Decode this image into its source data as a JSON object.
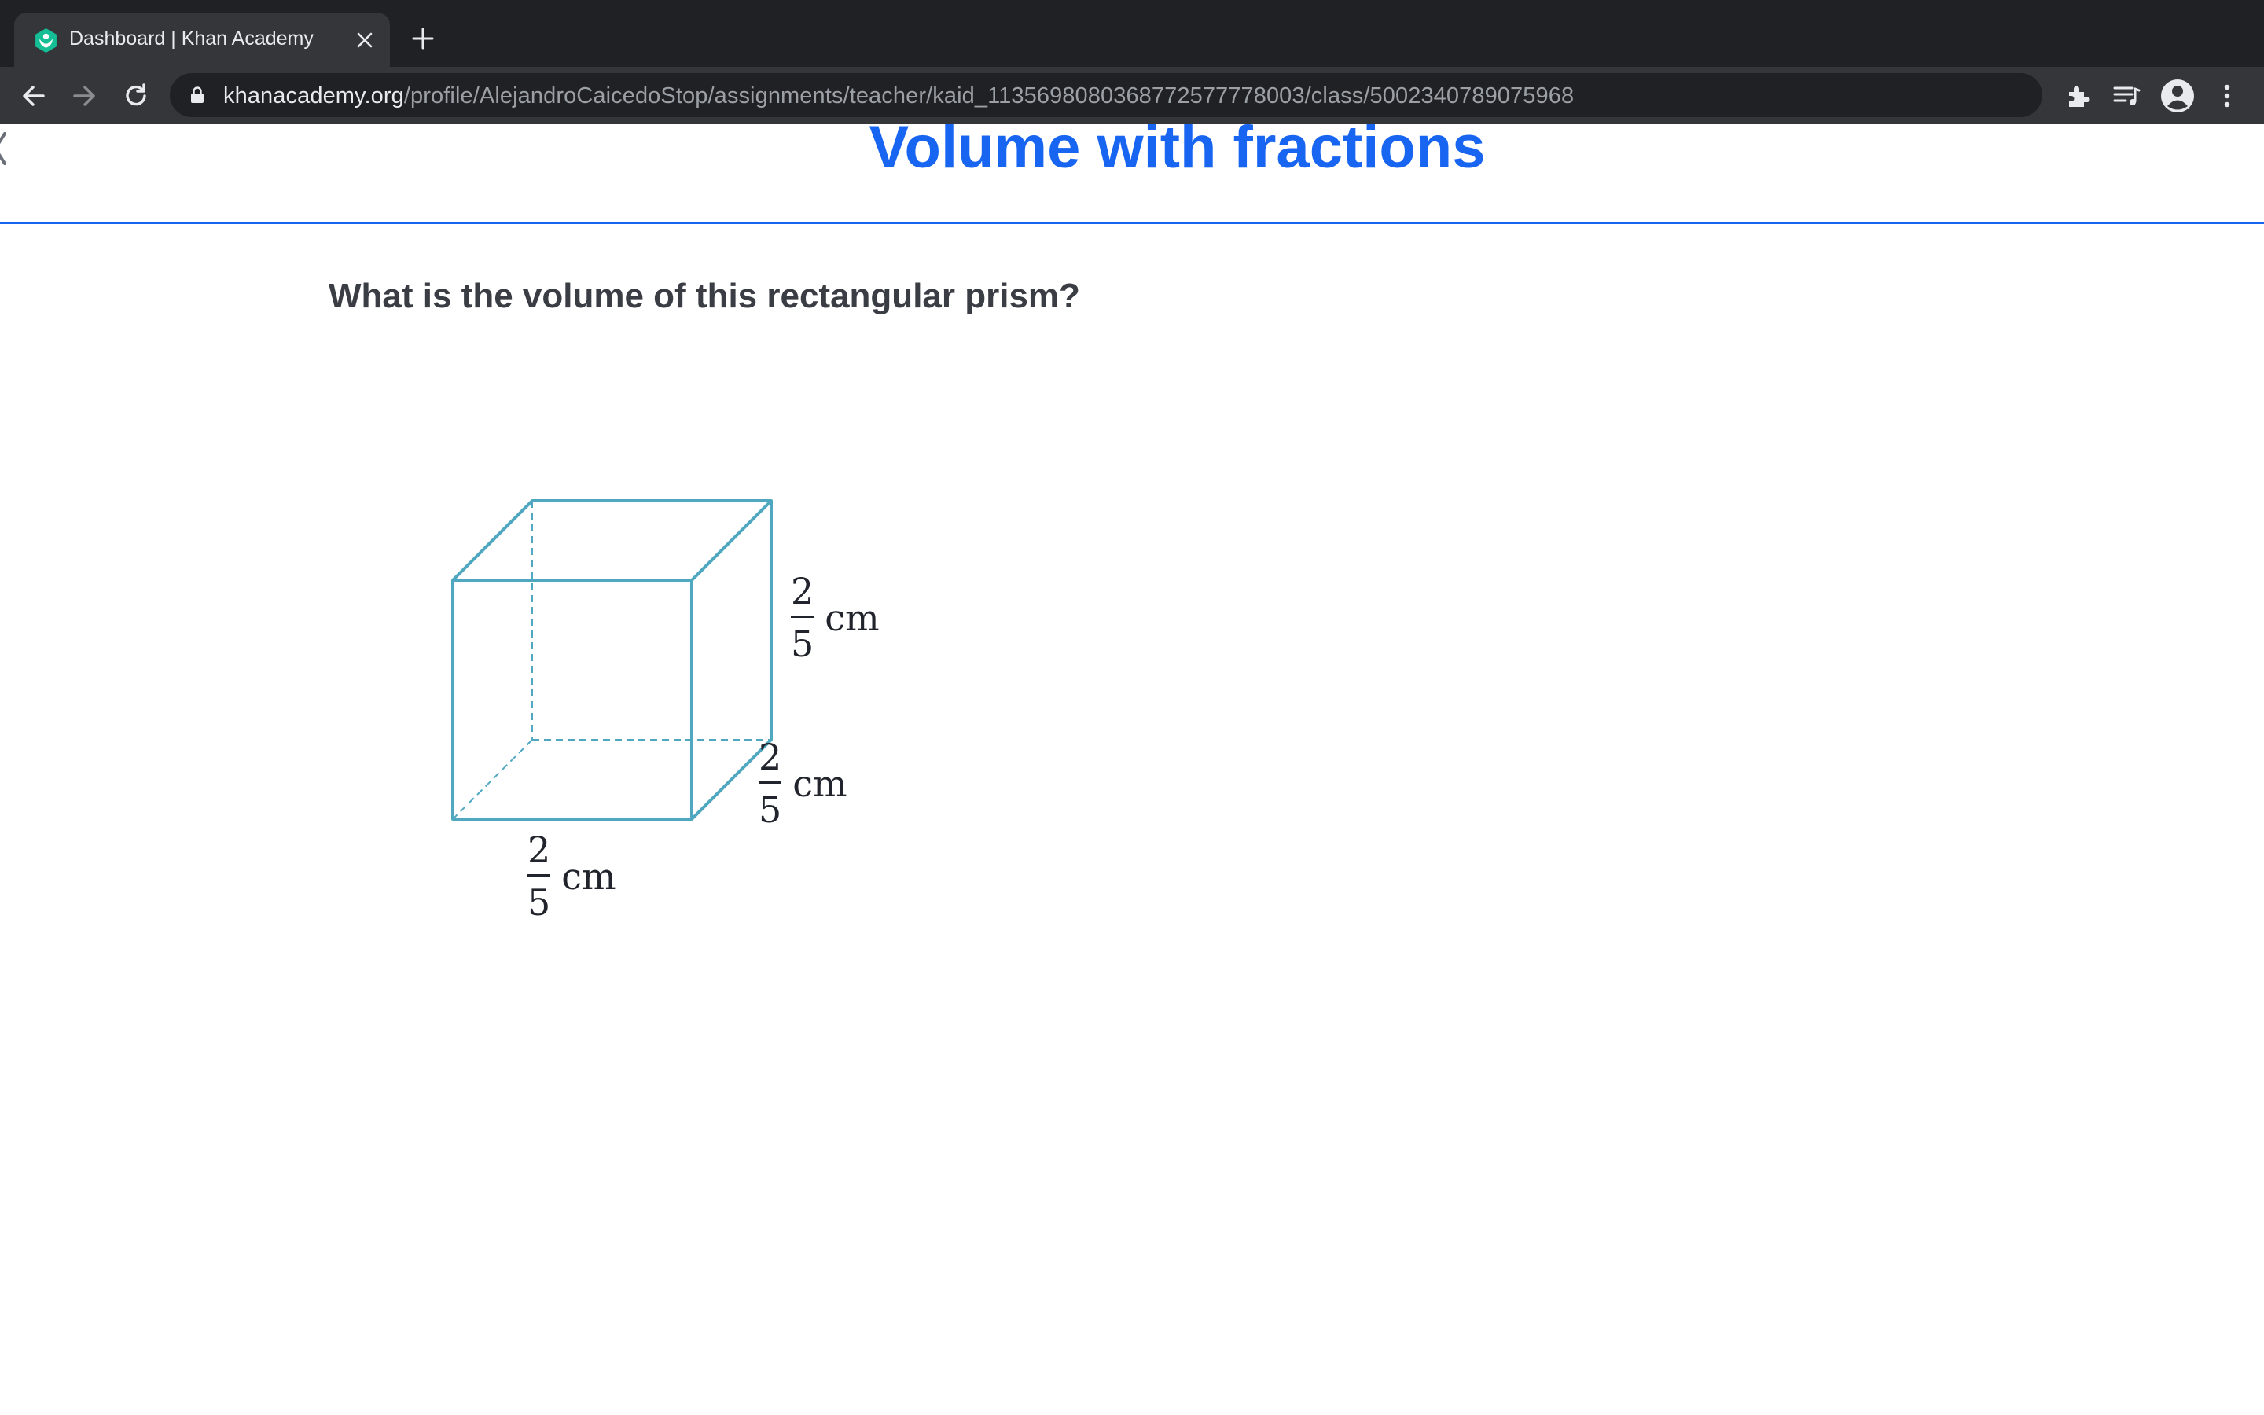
{
  "browser": {
    "tab_title": "Dashboard | Khan Academy",
    "url_host": "khanacademy.org",
    "url_path": "/profile/AlejandroCaicedoStop/assignments/teacher/kaid_1135698080368772577778003/class/5002340789075968",
    "icons": [
      "back-arrow-icon",
      "forward-arrow-icon",
      "reload-icon",
      "lock-icon",
      "star-icon",
      "extensions-icon",
      "reading-list-icon",
      "profile-icon",
      "kebab-menu-icon"
    ]
  },
  "page": {
    "title": "Volume with fractions",
    "question": "What is the volume of this rectangular prism?",
    "accent_color": "#1865f2",
    "prism_color": "#4fa8c0"
  },
  "figure": {
    "height_label": {
      "numerator": "2",
      "denominator": "5",
      "unit": "cm"
    },
    "depth_label": {
      "numerator": "2",
      "denominator": "5",
      "unit": "cm"
    },
    "width_label": {
      "numerator": "2",
      "denominator": "5",
      "unit": "cm"
    }
  }
}
